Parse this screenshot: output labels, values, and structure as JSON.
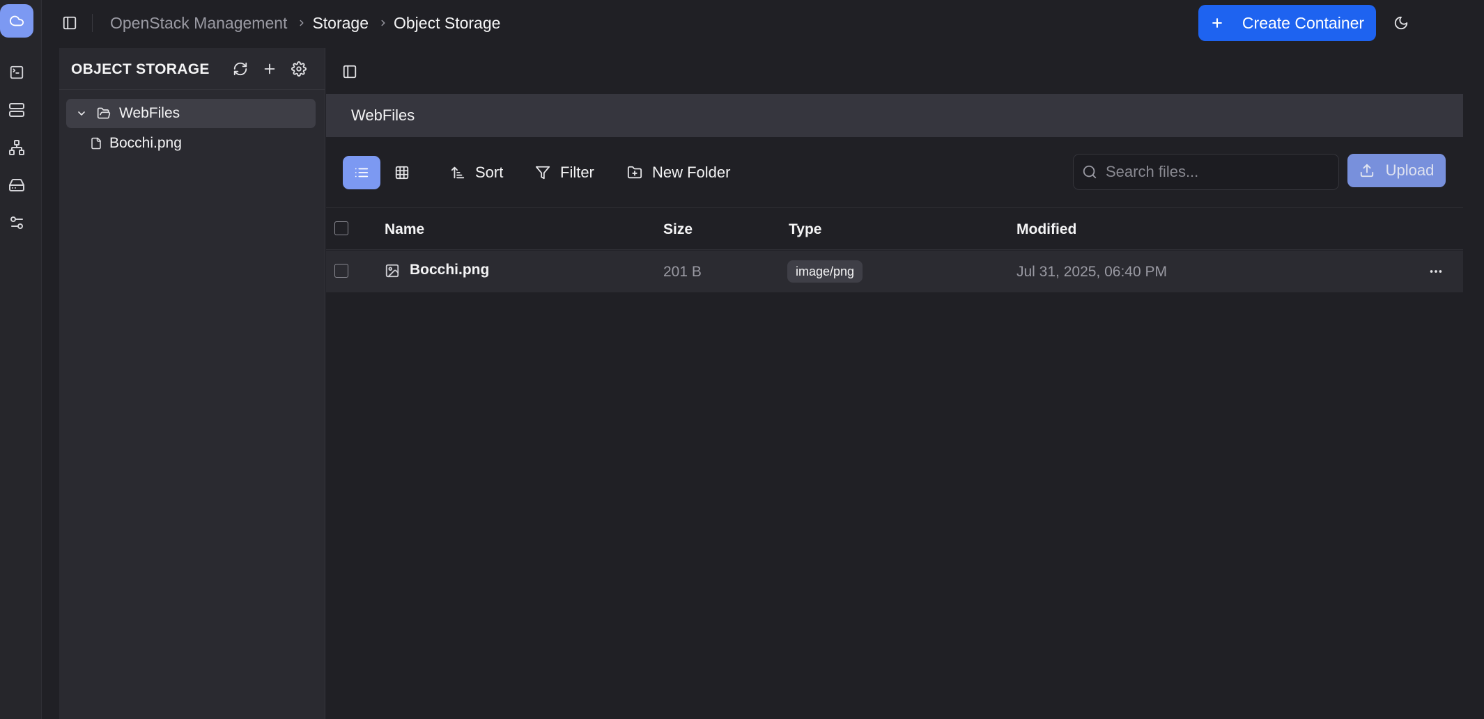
{
  "breadcrumb": {
    "items": [
      "OpenStack Management",
      "Storage",
      "Object Storage"
    ]
  },
  "header": {
    "create_button_label": "Create Container"
  },
  "tree": {
    "title": "OBJECT STORAGE",
    "container": "WebFiles",
    "files": [
      "Bocchi.png"
    ]
  },
  "main": {
    "current_path": "WebFiles",
    "toolbar": {
      "sort_label": "Sort",
      "filter_label": "Filter",
      "new_folder_label": "New Folder",
      "search_placeholder": "Search files...",
      "upload_label": "Upload"
    },
    "table": {
      "columns": [
        "Name",
        "Size",
        "Type",
        "Modified"
      ],
      "rows": [
        {
          "name": "Bocchi.png",
          "size": "201 B",
          "type": "image/png",
          "modified": "Jul 31, 2025, 06:40 PM"
        }
      ]
    }
  },
  "colors": {
    "accent": "#1e63f0",
    "accent_soft": "#7c99f2",
    "background": "#202025",
    "panel": "#2a2a30"
  },
  "icons": {
    "rail": [
      "cloud-icon",
      "terminal-icon",
      "server-icon",
      "network-icon",
      "drive-icon",
      "settings-sliders-icon"
    ]
  }
}
